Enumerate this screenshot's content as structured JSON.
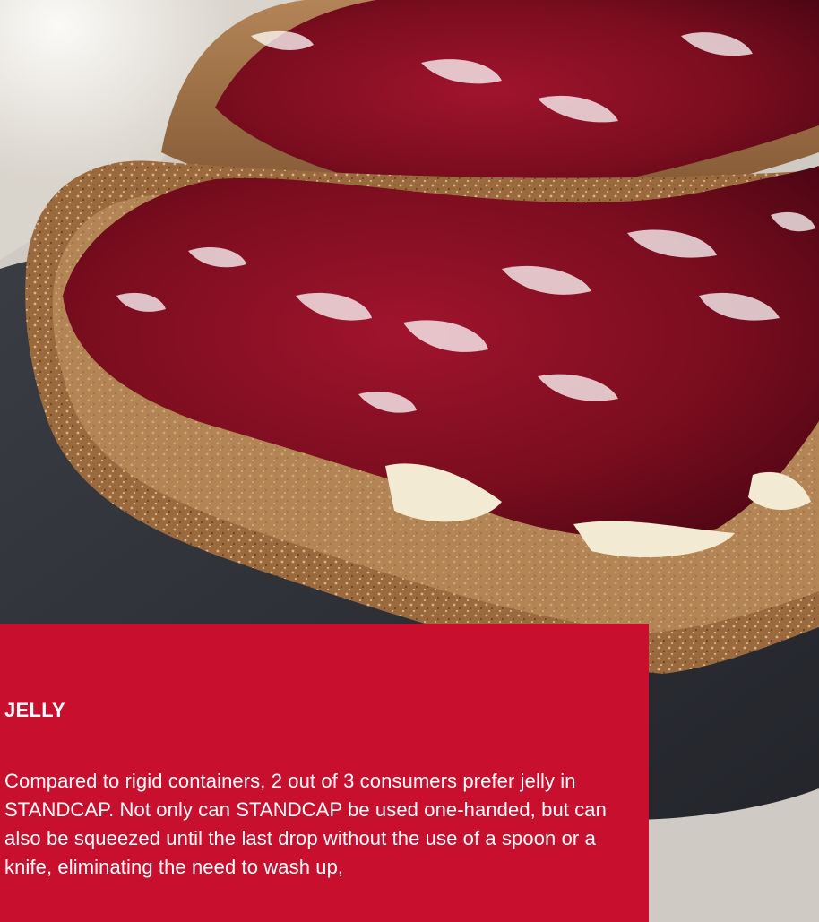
{
  "photo": {
    "subject": "bread-with-jelly",
    "colors": {
      "jelly": "#7a0d1f",
      "bread_crust": "#9a6a3e",
      "bread_crumb": "#c89a66",
      "plate_white": "#eeeae4",
      "plate_dark": "#2e3138",
      "butter": "#f3ead3",
      "cloth": "#cfcac3"
    }
  },
  "panel": {
    "background": "#c8102e",
    "heading": "JELLY",
    "body": "Compared to rigid containers, 2 out of 3 consumers prefer jelly in STANDCAP. Not only can STANDCAP be used one-handed, but can also be squeezed until the last drop without the use of a spoon or a knife, eliminating the need to wash up,"
  }
}
